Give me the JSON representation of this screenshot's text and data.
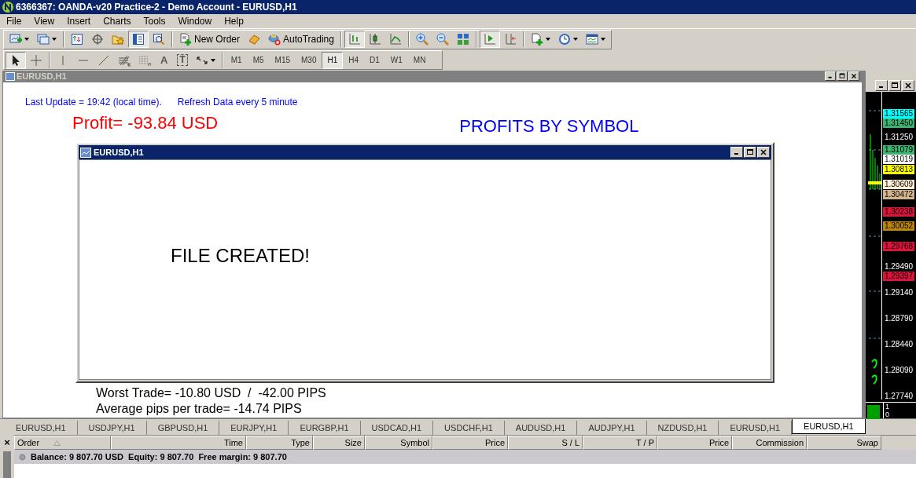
{
  "window": {
    "title": "6366367: OANDA-v20 Practice-2 - Demo Account - EURUSD,H1"
  },
  "menu": [
    "File",
    "View",
    "Insert",
    "Charts",
    "Tools",
    "Window",
    "Help"
  ],
  "toolbars": [
    {
      "groups": [
        [
          {
            "kind": "new-chart",
            "pressed": false,
            "dropdown": true
          },
          {
            "kind": "profiles",
            "pressed": false,
            "dropdown": true
          }
        ],
        [
          {
            "kind": "market-watch",
            "pressed": false
          },
          {
            "kind": "crosshair",
            "pressed": false
          },
          {
            "kind": "navigator",
            "pressed": false
          },
          {
            "kind": "terminal",
            "pressed": true
          },
          {
            "kind": "tester",
            "pressed": false
          }
        ],
        [
          {
            "kind": "new-order",
            "pressed": false,
            "label": "New Order"
          },
          {
            "kind": "metaeditor",
            "pressed": false
          },
          {
            "kind": "autotrading",
            "pressed": false,
            "label": "AutoTrading"
          }
        ],
        [
          {
            "kind": "bars",
            "pressed": true
          },
          {
            "kind": "candles",
            "pressed": false
          },
          {
            "kind": "line",
            "pressed": false
          }
        ],
        [
          {
            "kind": "zoom-in",
            "pressed": false
          },
          {
            "kind": "zoom-out",
            "pressed": false
          },
          {
            "kind": "tile",
            "pressed": false
          }
        ],
        [
          {
            "kind": "autoscroll",
            "pressed": true
          },
          {
            "kind": "shift",
            "pressed": false
          }
        ],
        [
          {
            "kind": "indicators",
            "pressed": false,
            "dropdown": true
          },
          {
            "kind": "periods",
            "pressed": false,
            "dropdown": true
          },
          {
            "kind": "templates",
            "pressed": false,
            "dropdown": true
          }
        ]
      ]
    },
    {
      "groups": [
        [
          {
            "kind": "cursor",
            "pressed": true
          },
          {
            "kind": "crosshair-thin",
            "pressed": false
          }
        ],
        [
          {
            "kind": "vline",
            "pressed": false
          },
          {
            "kind": "hline",
            "pressed": false
          },
          {
            "kind": "trendline",
            "pressed": false
          },
          {
            "kind": "fibo-e",
            "pressed": false
          },
          {
            "kind": "fibo-f",
            "pressed": false
          },
          {
            "kind": "text",
            "pressed": false,
            "label": "A"
          },
          {
            "kind": "text-label",
            "pressed": false,
            "label": "T"
          },
          {
            "kind": "arrows",
            "pressed": false,
            "dropdown": true
          }
        ]
      ]
    }
  ],
  "timeframes": [
    {
      "label": "M1",
      "selected": false
    },
    {
      "label": "M5",
      "selected": false
    },
    {
      "label": "M15",
      "selected": false
    },
    {
      "label": "M30",
      "selected": false
    },
    {
      "label": "H1",
      "selected": true
    },
    {
      "label": "H4",
      "selected": false
    },
    {
      "label": "D1",
      "selected": false
    },
    {
      "label": "W1",
      "selected": false
    },
    {
      "label": "MN",
      "selected": false
    }
  ],
  "chart_window": {
    "title": "EURUSD,H1",
    "last_update": "Last Update = 19:42 (local time).",
    "refresh": "Refresh Data every 5 minute",
    "profit": "Profit= -93.84 USD",
    "heading": "PROFITS BY SYMBOL",
    "worst_trade": "Worst Trade= -10.80 USD  /  -42.00 PIPS",
    "average": "Average pips per trade= -14.74 PIPS"
  },
  "dialog": {
    "title": "EURUSD,H1",
    "message": "FILE CREATED!"
  },
  "side_chart": {
    "price_labels": [
      {
        "text": "1.31565",
        "color": "#00ffff"
      },
      {
        "text": "1.31450",
        "color": "#3cb371"
      },
      {
        "text": "1.31250"
      },
      {
        "text": "1.31079",
        "color": "#3cb371"
      },
      {
        "text": "1.31019",
        "color": "#ffffff"
      },
      {
        "text": "1.30813",
        "color": "#ffff00"
      },
      {
        "text": "1.30609",
        "color": "#ffefd5"
      },
      {
        "text": "1.30472",
        "color": "#d2b48c"
      },
      {
        "text": "1.30238",
        "color": "#dc143c"
      },
      {
        "text": "1.30052",
        "color": "#b8860b"
      },
      {
        "text": "1.29768",
        "color": "#dc143c"
      },
      {
        "text": "1.29490"
      },
      {
        "text": "1.29397",
        "color": "#dc143c"
      },
      {
        "text": "1.29140"
      },
      {
        "text": "1.28790"
      },
      {
        "text": "1.28440"
      },
      {
        "text": "1.28090"
      },
      {
        "text": "1.27740"
      }
    ],
    "indicator_scale": [
      "1",
      "0"
    ]
  },
  "chart_tabs": [
    {
      "label": "EURUSD,H1",
      "selected": false
    },
    {
      "label": "USDJPY,H1",
      "selected": false
    },
    {
      "label": "GBPUSD,H1",
      "selected": false
    },
    {
      "label": "EURJPY,H1",
      "selected": false
    },
    {
      "label": "EURGBP,H1",
      "selected": false
    },
    {
      "label": "USDCAD,H1",
      "selected": false
    },
    {
      "label": "USDCHF,H1",
      "selected": false
    },
    {
      "label": "AUDUSD,H1",
      "selected": false
    },
    {
      "label": "AUDJPY,H1",
      "selected": false
    },
    {
      "label": "NZDUSD,H1",
      "selected": false
    },
    {
      "label": "EURUSD,H1",
      "selected": false
    },
    {
      "label": "EURUSD,H1",
      "selected": true
    }
  ],
  "terminal": {
    "close": "×",
    "columns": [
      "Order",
      "Time",
      "Type",
      "Size",
      "Symbol",
      "Price",
      "S / L",
      "T / P",
      "Price",
      "Commission",
      "Swap"
    ],
    "balance": "Balance: 9 807.70 USD  Equity: 9 807.70  Free margin: 9 807.70"
  }
}
